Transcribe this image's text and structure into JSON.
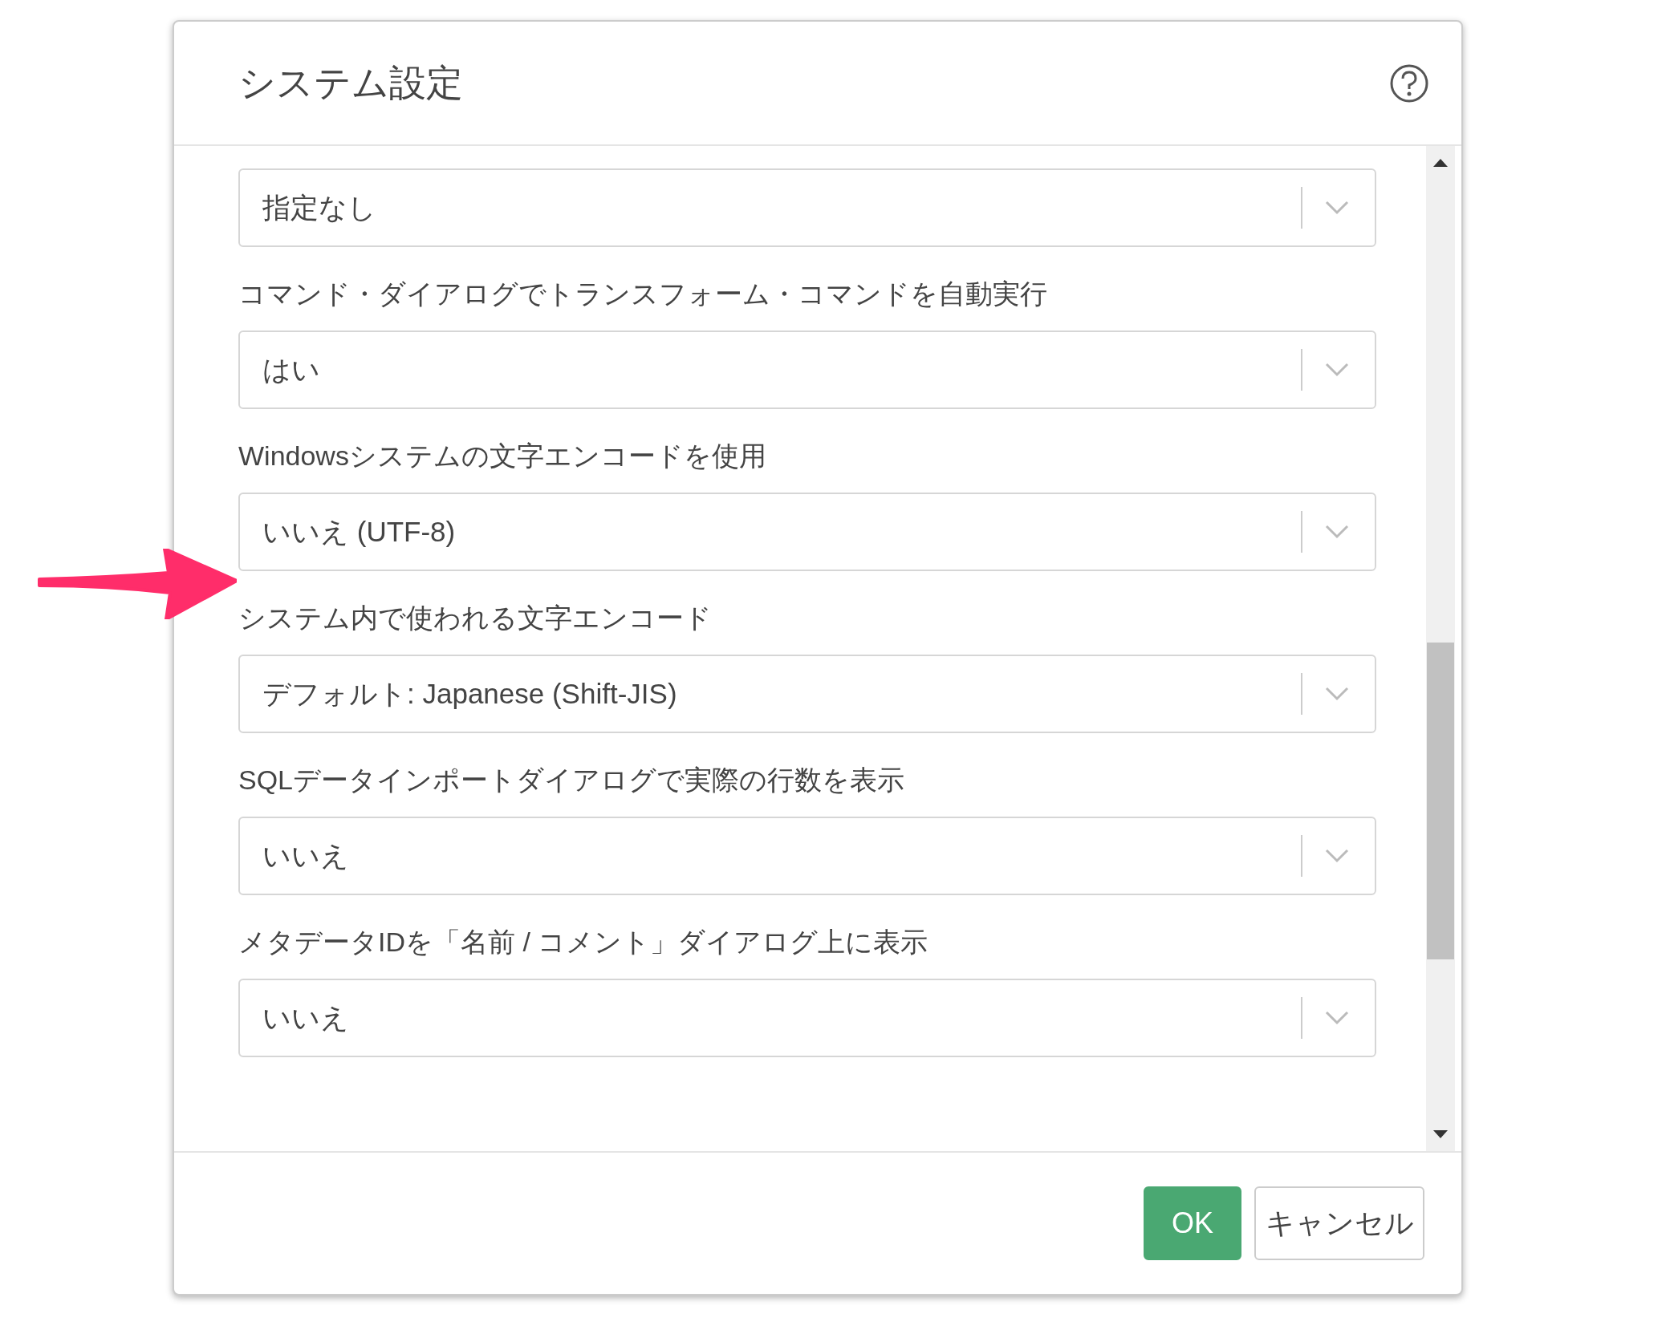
{
  "dialog": {
    "title": "システム設定",
    "settings": [
      {
        "value": "指定なし"
      },
      {
        "label": "コマンド・ダイアログでトランスフォーム・コマンドを自動実行",
        "value": "はい"
      },
      {
        "label": "Windowsシステムの文字エンコードを使用",
        "value": "いいえ (UTF-8)"
      },
      {
        "label": "システム内で使われる文字エンコード",
        "value": "デフォルト: Japanese (Shift-JIS)"
      },
      {
        "label": "SQLデータインポートダイアログで実際の行数を表示",
        "value": "いいえ"
      },
      {
        "label": "メタデータIDを「名前 / コメント」ダイアログ上に表示",
        "value": "いいえ"
      }
    ],
    "buttons": [
      {
        "label": "OK",
        "kind": "primary"
      },
      {
        "label": "キャンセル",
        "kind": "secondary"
      }
    ]
  }
}
